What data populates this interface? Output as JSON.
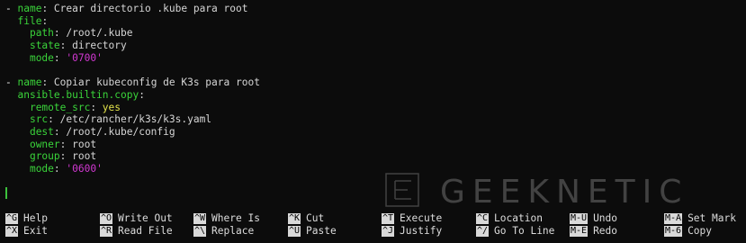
{
  "editor": {
    "lines": [
      {
        "indent": "",
        "dash": "- ",
        "key": "name",
        "sep": ": ",
        "value": "Crear directorio .kube para root",
        "vtype": "val"
      },
      {
        "indent": "  ",
        "dash": "",
        "key": "file",
        "sep": ":",
        "value": "",
        "vtype": "val"
      },
      {
        "indent": "    ",
        "dash": "",
        "key": "path",
        "sep": ": ",
        "value": "/root/.kube",
        "vtype": "val"
      },
      {
        "indent": "    ",
        "dash": "",
        "key": "state",
        "sep": ": ",
        "value": "directory",
        "vtype": "val"
      },
      {
        "indent": "    ",
        "dash": "",
        "key": "mode",
        "sep": ": ",
        "value": "'0700'",
        "vtype": "str"
      },
      {
        "indent": "",
        "dash": "",
        "key": "",
        "sep": "",
        "value": "",
        "vtype": "val"
      },
      {
        "indent": "",
        "dash": "- ",
        "key": "name",
        "sep": ": ",
        "value": "Copiar kubeconfig de K3s para root",
        "vtype": "val"
      },
      {
        "indent": "  ",
        "dash": "",
        "key": "ansible.builtin.copy",
        "sep": ":",
        "value": "",
        "vtype": "val"
      },
      {
        "indent": "    ",
        "dash": "",
        "key": "remote_src",
        "sep": ": ",
        "value": "yes",
        "vtype": "bool"
      },
      {
        "indent": "    ",
        "dash": "",
        "key": "src",
        "sep": ": ",
        "value": "/etc/rancher/k3s/k3s.yaml",
        "vtype": "val"
      },
      {
        "indent": "    ",
        "dash": "",
        "key": "dest",
        "sep": ": ",
        "value": "/root/.kube/config",
        "vtype": "val"
      },
      {
        "indent": "    ",
        "dash": "",
        "key": "owner",
        "sep": ": ",
        "value": "root",
        "vtype": "val"
      },
      {
        "indent": "    ",
        "dash": "",
        "key": "group",
        "sep": ": ",
        "value": "root",
        "vtype": "val"
      },
      {
        "indent": "    ",
        "dash": "",
        "key": "mode",
        "sep": ": ",
        "value": "'0600'",
        "vtype": "str"
      }
    ]
  },
  "watermark": {
    "text": "GEEKNETIC"
  },
  "shortcuts": [
    {
      "key": "^G",
      "label": "Help"
    },
    {
      "key": "^X",
      "label": "Exit"
    },
    {
      "key": "^O",
      "label": "Write Out"
    },
    {
      "key": "^R",
      "label": "Read File"
    },
    {
      "key": "^W",
      "label": "Where Is"
    },
    {
      "key": "^\\",
      "label": "Replace"
    },
    {
      "key": "^K",
      "label": "Cut"
    },
    {
      "key": "^U",
      "label": "Paste"
    },
    {
      "key": "^T",
      "label": "Execute"
    },
    {
      "key": "^J",
      "label": "Justify"
    },
    {
      "key": "^C",
      "label": "Location"
    },
    {
      "key": "^/",
      "label": "Go To Line"
    },
    {
      "key": "M-U",
      "label": "Undo"
    },
    {
      "key": "M-E",
      "label": "Redo"
    },
    {
      "key": "M-A",
      "label": "Set Mark"
    },
    {
      "key": "M-6",
      "label": "Copy"
    }
  ],
  "colors": {
    "background": "#0c0c0c",
    "key": "#3ad43a",
    "bool": "#e3e34b",
    "string": "#d238d2",
    "shortcut_key_bg": "#d9d9d9"
  }
}
